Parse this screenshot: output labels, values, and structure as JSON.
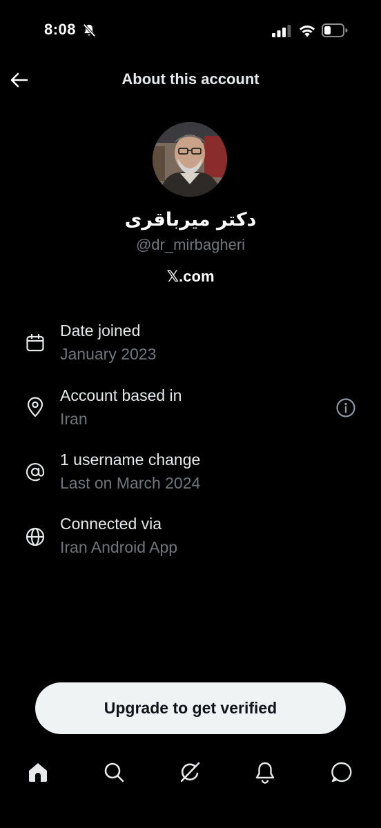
{
  "status_bar": {
    "time": "8:08"
  },
  "header": {
    "title": "About this account"
  },
  "profile": {
    "display_name": "دکتر میرباقری",
    "handle": "@dr_mirbagheri",
    "site": "𝕏.com"
  },
  "details": [
    {
      "icon": "calendar-icon",
      "title": "Date joined",
      "value": "January 2023"
    },
    {
      "icon": "location-pin-icon",
      "title": "Account based in",
      "value": "Iran"
    },
    {
      "icon": "at-sign-icon",
      "title": "1 username change",
      "value": "Last on March 2024"
    },
    {
      "icon": "globe-icon",
      "title": "Connected via",
      "value": "Iran Android App"
    }
  ],
  "upgrade_button": {
    "label": "Upgrade to get verified"
  },
  "bottom_nav": [
    "home-icon",
    "search-icon",
    "grok-icon",
    "notifications-icon",
    "messages-icon"
  ],
  "colors": {
    "background": "#000000",
    "primary_text": "#e7e9ea",
    "secondary_text": "#71767b",
    "button_bg": "#eff3f4"
  }
}
